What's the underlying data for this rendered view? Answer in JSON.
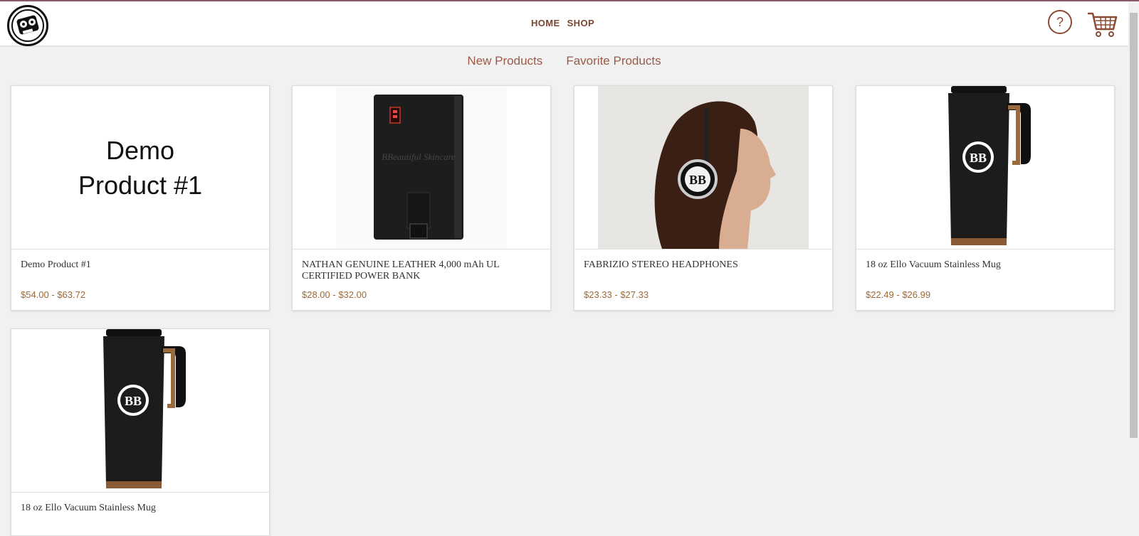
{
  "nav": {
    "home": "HOME",
    "shop": "SHOP"
  },
  "header": {
    "help_symbol": "?",
    "help_icon": "help-icon",
    "cart_icon": "cart-icon",
    "logo_icon": "robot-logo-icon"
  },
  "tabs": {
    "new": "New Products",
    "favorite": "Favorite Products"
  },
  "products": [
    {
      "image_text": "Demo Product #1",
      "name": "Demo Product #1",
      "price": "$54.00 - $63.72"
    },
    {
      "name": "NATHAN GENUINE LEATHER 4,000 mAh UL CERTIFIED POWER BANK",
      "price": "$28.00 - $32.00",
      "image_text": "BBeautiful Skincare"
    },
    {
      "name": "FABRIZIO STEREO HEADPHONES",
      "price": "$23.33 - $27.33",
      "image_text": "BB"
    },
    {
      "name": "18 oz Ello Vacuum Stainless Mug",
      "price": "$22.49 - $26.99",
      "image_text": "BB"
    },
    {
      "name": "18 oz Ello Vacuum Stainless Mug",
      "image_text": "BB"
    }
  ],
  "colors": {
    "accent": "#8b4a34",
    "price": "#9a6a38",
    "background": "#f1f1f1"
  }
}
